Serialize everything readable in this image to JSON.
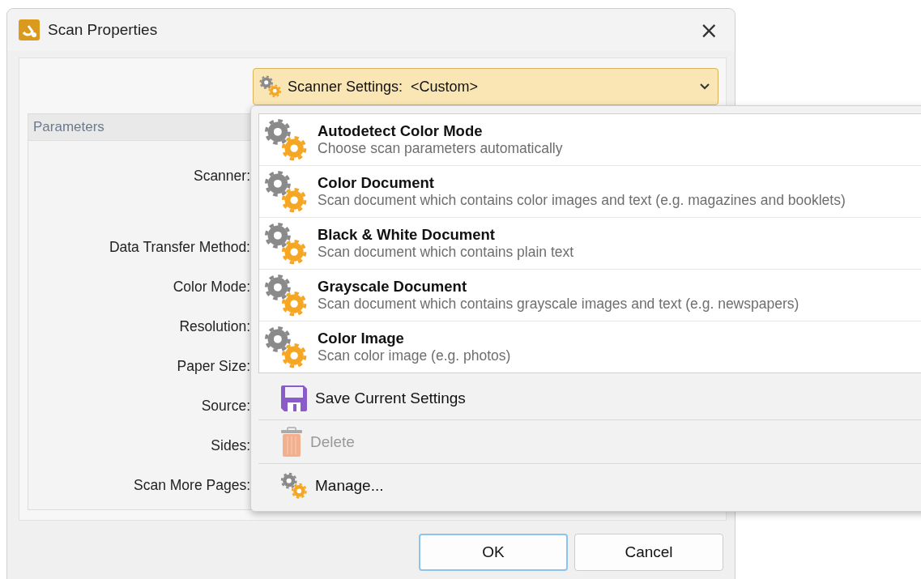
{
  "window": {
    "title": "Scan Properties",
    "close": "×"
  },
  "scanner_settings": {
    "label": "Scanner Settings:  <Custom>",
    "expanded": true
  },
  "parameters": {
    "title": "Parameters",
    "labels": [
      "Scanner:",
      "Data Transfer Method:",
      "Color Mode:",
      "Resolution:",
      "Paper Size:",
      "Source:",
      "Sides:",
      "Scan More Pages:"
    ]
  },
  "presets": [
    {
      "title": "Autodetect Color Mode",
      "description": "Choose scan parameters automatically"
    },
    {
      "title": "Color Document",
      "description": "Scan document which contains color images and text (e.g. magazines and booklets)"
    },
    {
      "title": "Black & White Document",
      "description": "Scan document which contains plain text"
    },
    {
      "title": "Grayscale Document",
      "description": "Scan document which contains grayscale images and text (e.g. newspapers)"
    },
    {
      "title": "Color Image",
      "description": "Scan color image (e.g. photos)"
    }
  ],
  "actions": [
    {
      "kind": "save",
      "label": "Save Current Settings",
      "disabled": false
    },
    {
      "kind": "delete",
      "label": "Delete",
      "disabled": true
    },
    {
      "kind": "manage",
      "label": "Manage...",
      "disabled": false
    }
  ],
  "buttons": [
    {
      "label": "OK",
      "default": true
    },
    {
      "label": "Cancel",
      "default": false
    }
  ]
}
